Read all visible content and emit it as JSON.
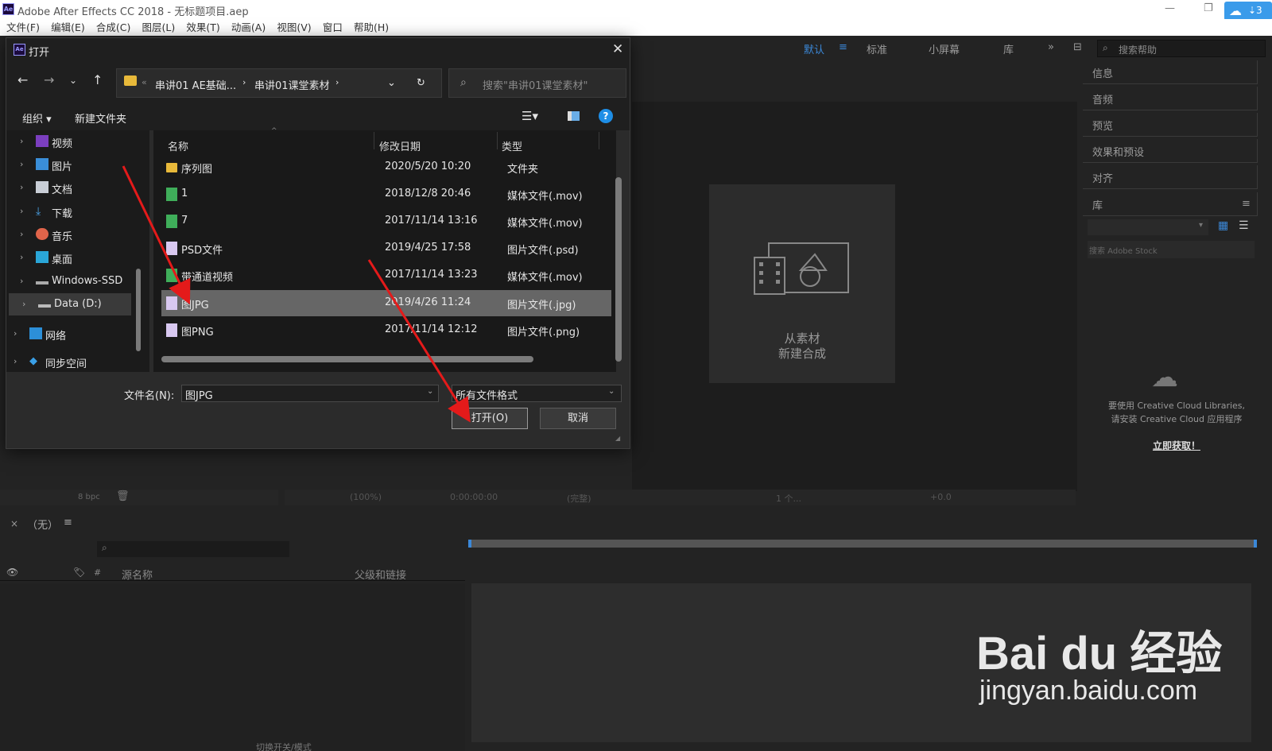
{
  "app": {
    "window_title": "Adobe After Effects CC 2018 - 无标题项目.aep",
    "app_icon_text": "Ae",
    "menu": [
      "文件(F)",
      "编辑(E)",
      "合成(C)",
      "图层(L)",
      "效果(T)",
      "动画(A)",
      "视图(V)",
      "窗口",
      "帮助(H)"
    ]
  },
  "workspaces": {
    "items": [
      "默认",
      "标准",
      "小屏幕",
      "库"
    ],
    "active": "默认",
    "overflow": "»",
    "search_placeholder": "搜索帮助"
  },
  "right_panels": {
    "items": [
      "信息",
      "音频",
      "预览",
      "效果和预设",
      "对齐",
      "库"
    ],
    "stock_search": "搜索 Adobe Stock",
    "cc_message_1": "要使用 Creative Cloud Libraries,",
    "cc_message_2": "请安装 Creative Cloud 应用程序",
    "cc_link": "立即获取！"
  },
  "composition": {
    "new_comp_line1": "从素材",
    "new_comp_line2": "新建合成",
    "viewer_zoom": "(100%)",
    "timecode": "0:00:00:00",
    "resolution": "(完整)",
    "view": "1 个...",
    "exposure": "+0.0",
    "bpc": "8 bpc"
  },
  "timeline": {
    "comp_name": "（无）",
    "col_source": "源名称",
    "col_parent": "父级和链接",
    "toggle_label": "切换开关/模式"
  },
  "dialog": {
    "title": "打开",
    "close": "✕",
    "breadcrumb": [
      "串讲01 AE基础...",
      "串讲01课堂素材"
    ],
    "search_placeholder": "搜索\"串讲01课堂素材\"",
    "organize": "组织 ▾",
    "new_folder": "新建文件夹",
    "help": "?",
    "nav_items": [
      {
        "label": "视频",
        "icon": "video-folder-icon"
      },
      {
        "label": "图片",
        "icon": "pictures-folder-icon"
      },
      {
        "label": "文档",
        "icon": "documents-folder-icon"
      },
      {
        "label": "下载",
        "icon": "download-icon"
      },
      {
        "label": "音乐",
        "icon": "music-icon"
      },
      {
        "label": "桌面",
        "icon": "desktop-icon"
      },
      {
        "label": "Windows-SSD",
        "icon": "drive-icon"
      },
      {
        "label": "Data (D:)",
        "icon": "drive-icon"
      },
      {
        "label": "网络",
        "icon": "network-icon"
      },
      {
        "label": "同步空间",
        "icon": "sync-icon"
      }
    ],
    "columns": [
      "名称",
      "修改日期",
      "类型"
    ],
    "files": [
      {
        "name": "序列图",
        "date": "2020/5/20 10:20",
        "type": "文件夹",
        "icon": "folder"
      },
      {
        "name": "1",
        "date": "2018/12/8 20:46",
        "type": "媒体文件(.mov)",
        "icon": "media"
      },
      {
        "name": "7",
        "date": "2017/11/14 13:16",
        "type": "媒体文件(.mov)",
        "icon": "media"
      },
      {
        "name": "PSD文件",
        "date": "2019/4/25 17:58",
        "type": "图片文件(.psd)",
        "icon": "image"
      },
      {
        "name": "带通道视频",
        "date": "2017/11/14 13:23",
        "type": "媒体文件(.mov)",
        "icon": "media"
      },
      {
        "name": "图JPG",
        "date": "2019/4/26 11:24",
        "type": "图片文件(.jpg)",
        "icon": "image"
      },
      {
        "name": "图PNG",
        "date": "2017/11/14 12:12",
        "type": "图片文件(.png)",
        "icon": "image"
      }
    ],
    "selected_file": "图JPG",
    "filename_label": "文件名(N):",
    "filename_value": "图JPG",
    "filetype_value": "所有文件格式",
    "open_button": "打开(O)",
    "cancel_button": "取消"
  },
  "watermark": {
    "brand": "Bai du 经验",
    "url": "jingyan.baidu.com"
  },
  "colors": {
    "accent_blue": "#3b88d8",
    "arrow_red": "#e41a1a",
    "selection_gray": "#666666"
  }
}
